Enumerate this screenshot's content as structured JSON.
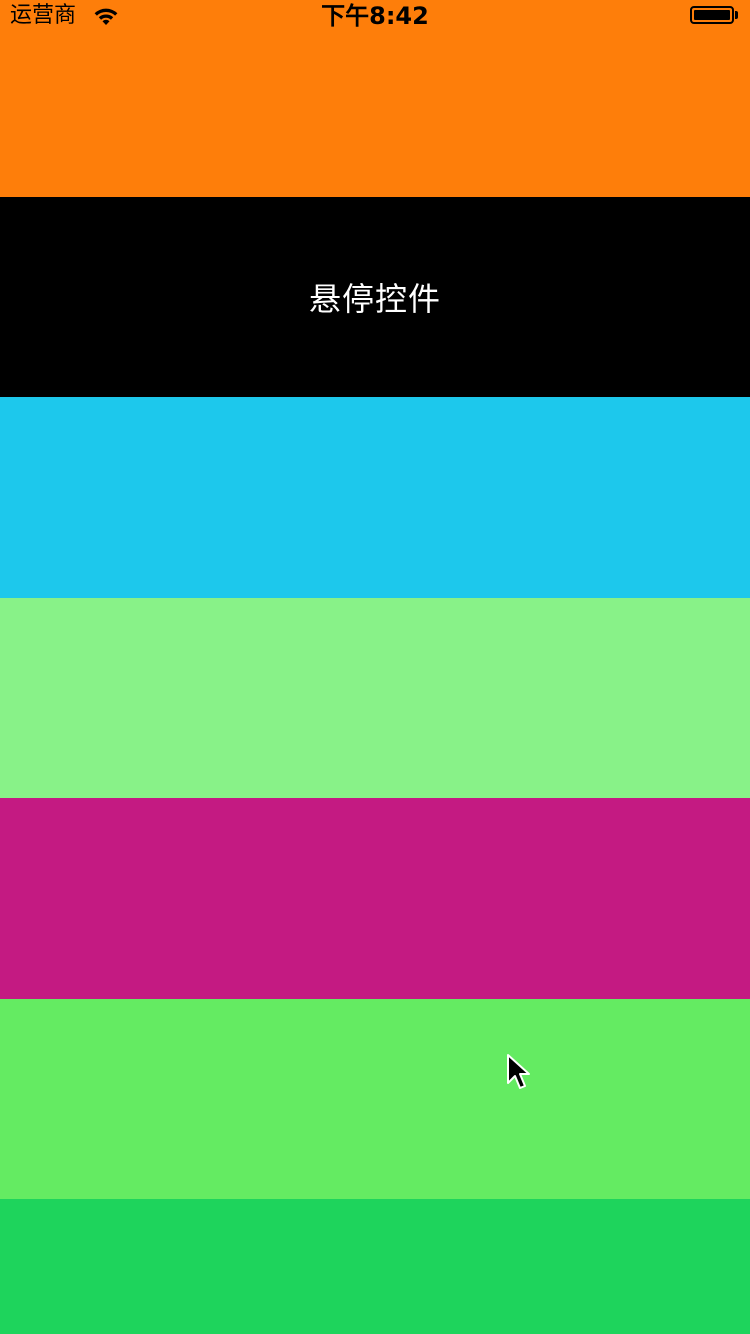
{
  "status_bar": {
    "carrier": "运营商",
    "time": "下午8:42",
    "wifi_icon": "wifi-icon",
    "battery_icon": "battery-icon"
  },
  "rows": [
    {
      "color": "#FE7E0A"
    },
    {
      "color": "#000000",
      "label": "悬停控件"
    },
    {
      "color": "#1DC8EC"
    },
    {
      "color": "#88F288"
    },
    {
      "color": "#C41A82"
    },
    {
      "color": "#64EB62"
    },
    {
      "color": "#1ED45C"
    }
  ],
  "cursor_icon": "mouse-pointer-icon"
}
